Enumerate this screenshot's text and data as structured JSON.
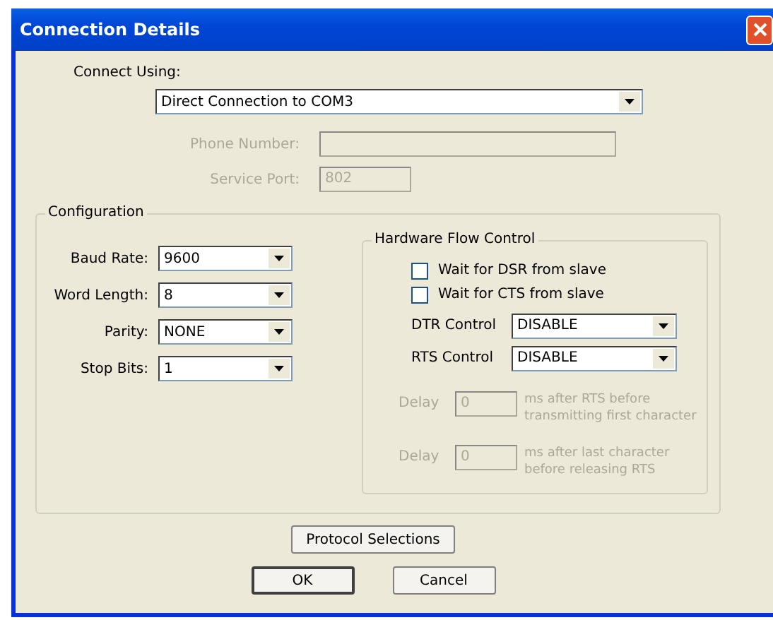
{
  "window": {
    "title": "Connection Details"
  },
  "connect_using": {
    "label": "Connect Using:",
    "value": "Direct Connection to COM3"
  },
  "phone_number": {
    "label": "Phone Number:",
    "disabled": true
  },
  "service_port": {
    "label": "Service Port:",
    "value": "802",
    "disabled": true
  },
  "configuration": {
    "title": "Configuration",
    "settings": [
      {
        "label": "Baud Rate:",
        "value": "9600"
      },
      {
        "label": "Word Length:",
        "value": "8"
      },
      {
        "label": "Parity:",
        "value": "NONE"
      },
      {
        "label": "Stop Bits:",
        "value": "1"
      }
    ],
    "hardware_flow_control": {
      "title": "Hardware Flow Control",
      "checkboxes": [
        {
          "label": "Wait for DSR from slave",
          "checked": false
        },
        {
          "label": "Wait for CTS from slave",
          "checked": false
        }
      ],
      "controls": [
        {
          "label": "DTR Control",
          "value": "DISABLE"
        },
        {
          "label": "RTS Control",
          "value": "DISABLE"
        }
      ],
      "delays": [
        {
          "label": "Delay",
          "value": "0",
          "note": "ms after RTS before transmitting first character",
          "disabled": true
        },
        {
          "label": "Delay",
          "value": "0",
          "note": "ms after last character before releasing RTS",
          "disabled": true
        }
      ]
    }
  },
  "buttons": [
    {
      "label": "Protocol Selections",
      "default": false
    },
    {
      "label": "OK",
      "default": true
    },
    {
      "label": "Cancel",
      "default": false
    }
  ]
}
